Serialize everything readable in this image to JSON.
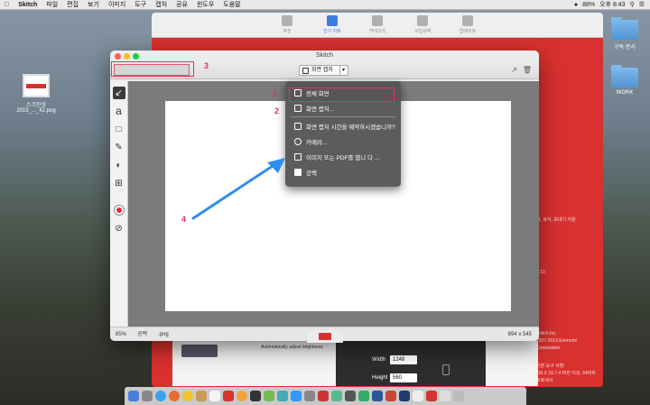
{
  "menubar": {
    "app": "Skitch",
    "items": [
      "파일",
      "편집",
      "보기",
      "이미지",
      "도구",
      "캡처",
      "공유",
      "윈도우",
      "도움말"
    ],
    "battery": "88%",
    "clock": "오후 8:43"
  },
  "desktop": {
    "file_label_1": "스크린샷",
    "file_label_2": "2015_..._42.png",
    "folder1": "구독 문서",
    "folder2": "WORK"
  },
  "store": {
    "tabs": [
      "추천",
      "인기 차트",
      "카테고리",
      "구입내역",
      "업데이트"
    ],
    "side_lines": [
      "가, 표식, 보내기 지원",
      "1.10",
      "2007-2013 Evernote Corporation",
      "기본 요구 사항:",
      "OS X 10.7.4 버전 이상, 64비트 프로세서"
    ],
    "developer": "Skitch Inc"
  },
  "skitch": {
    "title": "Skitch",
    "capture_label": "화면 캡처",
    "url_text": "",
    "zoom": "85%",
    "share_label": "공백",
    "format": ".png",
    "dimensions": "894 x 545"
  },
  "menu": {
    "items": [
      "전체 화면",
      "화면 캡처...",
      "화면 캡처 시간을 예약하시겠습니까?",
      "카메라...",
      "이미지 또는 PDF를 엽니 다 ...",
      "공백"
    ]
  },
  "annotations": {
    "n1": "1",
    "n2": "2",
    "n3": "3",
    "n4": "4"
  },
  "lower": {
    "width_label": "Width",
    "height_label": "Height",
    "width_value": "1248",
    "height_value": "560",
    "auto_text": "Automatically adjust brightness"
  }
}
